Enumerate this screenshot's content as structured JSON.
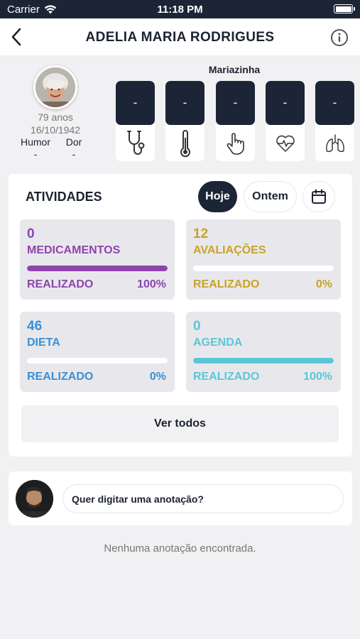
{
  "status_bar": {
    "carrier": "Carrier",
    "time": "11:18 PM"
  },
  "nav": {
    "title": "ADELIA MARIA RODRIGUES"
  },
  "patient": {
    "age": "79 anos",
    "birthdate": "16/10/1942",
    "humor_label": "Humor",
    "humor_value": "-",
    "dor_label": "Dor",
    "dor_value": "-",
    "nickname": "Mariazinha"
  },
  "vitals": [
    {
      "value": "-",
      "icon": "stethoscope-icon"
    },
    {
      "value": "-",
      "icon": "thermometer-icon"
    },
    {
      "value": "-",
      "icon": "hand-pointer-icon"
    },
    {
      "value": "-",
      "icon": "heart-pulse-icon"
    },
    {
      "value": "-",
      "icon": "lungs-icon"
    }
  ],
  "activities": {
    "title": "ATIVIDADES",
    "filters": {
      "today": "Hoje",
      "yesterday": "Ontem",
      "calendar_icon": "calendar-icon"
    },
    "cards": [
      {
        "count": "0",
        "label": "MEDICAMENTOS",
        "status": "REALIZADO",
        "percent": "100%",
        "progress": 1.0,
        "color": "#8e44ad"
      },
      {
        "count": "12",
        "label": "AVALIAÇÕES",
        "status": "REALIZADO",
        "percent": "0%",
        "progress": 0.0,
        "color": "#c9a227"
      },
      {
        "count": "46",
        "label": "DIETA",
        "status": "REALIZADO",
        "percent": "0%",
        "progress": 0.0,
        "color": "#3a8fd4"
      },
      {
        "count": "0",
        "label": "AGENDA",
        "status": "REALIZADO",
        "percent": "100%",
        "progress": 1.0,
        "color": "#5cc6d6"
      }
    ],
    "see_all": "Ver todos"
  },
  "notes": {
    "placeholder": "Quer digitar uma anotação?",
    "empty_message": "Nenhuma anotação encontrada."
  }
}
